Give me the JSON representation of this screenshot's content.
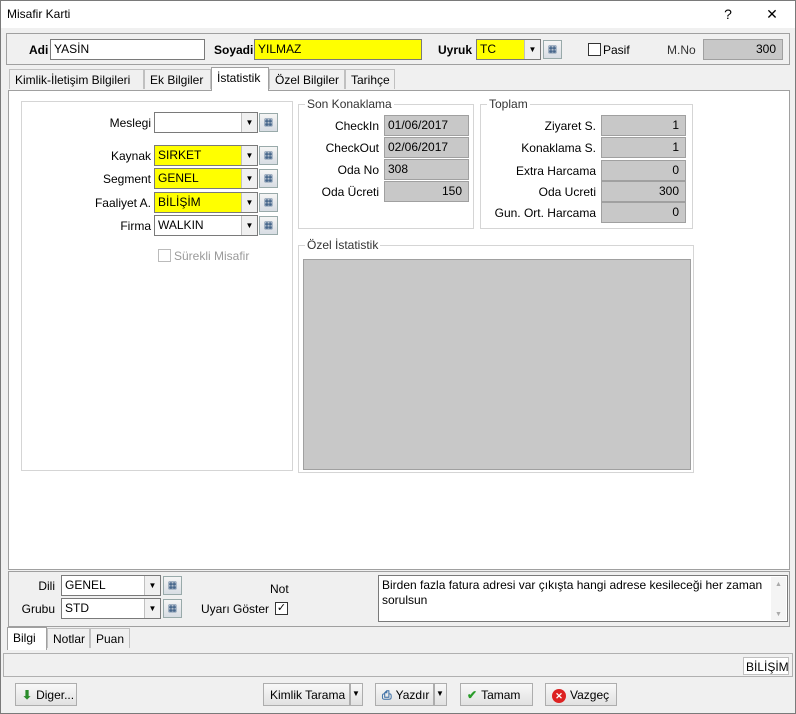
{
  "window": {
    "title": "Misafir Karti",
    "help_glyph": "?",
    "close_glyph": "✕"
  },
  "header": {
    "adi_label": "Adi",
    "adi_value": "YASİN",
    "soyadi_label": "Soyadi",
    "soyadi_value": "YILMAZ",
    "uyruk_label": "Uyruk",
    "uyruk_value": "TC",
    "pasif_label": "Pasif",
    "mno_label": "M.No",
    "mno_value": "300"
  },
  "tabs": [
    "Kimlik-İletişim Bilgileri",
    "Ek Bilgiler",
    "İstatistik",
    "Özel Bilgiler",
    "Tarihçe"
  ],
  "left_form": {
    "meslegi_label": "Meslegi",
    "meslegi_value": "",
    "kaynak_label": "Kaynak",
    "kaynak_value": "SIRKET",
    "segment_label": "Segment",
    "segment_value": "GENEL",
    "faaliyet_label": "Faaliyet A.",
    "faaliyet_value": "BİLİŞİM",
    "firma_label": "Firma",
    "firma_value": "WALKIN",
    "surekli_label": "Sürekli Misafir"
  },
  "son_konaklama": {
    "title": "Son Konaklama",
    "checkin_label": "CheckIn",
    "checkin_value": "01/06/2017",
    "checkout_label": "CheckOut",
    "checkout_value": "02/06/2017",
    "odano_label": "Oda No",
    "odano_value": "308",
    "odaucreti_label": "Oda Ücreti",
    "odaucreti_value": "150"
  },
  "toplam": {
    "title": "Toplam",
    "ziyaret_label": "Ziyaret S.",
    "ziyaret_value": "1",
    "konaklama_label": "Konaklama S.",
    "konaklama_value": "1",
    "extra_label": "Extra Harcama",
    "extra_value": "0",
    "odaucret_label": "Oda Ucreti",
    "odaucret_value": "300",
    "gunort_label": "Gun. Ort. Harcama",
    "gunort_value": "0"
  },
  "ozel_istatistik": {
    "title": "Özel İstatistik"
  },
  "bottom_form": {
    "dili_label": "Dili",
    "dili_value": "GENEL",
    "grubu_label": "Grubu",
    "grubu_value": "STD",
    "not_label": "Not",
    "uyari_label": "Uyarı Göster",
    "note_text": "Birden fazla fatura adresi var çıkışta hangi adrese kesileceği her zaman sorulsun"
  },
  "bottom_tabs": [
    "Bilgi",
    "Notlar",
    "Puan"
  ],
  "status": {
    "right_text": "BİLİŞİM"
  },
  "buttons": {
    "diger": "Diger...",
    "kimlik_tarama": "Kimlik Tarama",
    "yazdir": "Yazdır",
    "tamam": "Tamam",
    "vazgec": "Vazgeç"
  },
  "colors": {
    "required_field": "#ffff00",
    "readonly_field": "#c8c8c8"
  },
  "icons": {
    "lookup": "lookup-icon",
    "dropdown": "chevron-down-icon",
    "down_arrow": "arrow-down-icon",
    "checkmark": "checkmark-icon",
    "cancel": "cancel-icon",
    "print": "print-icon"
  }
}
